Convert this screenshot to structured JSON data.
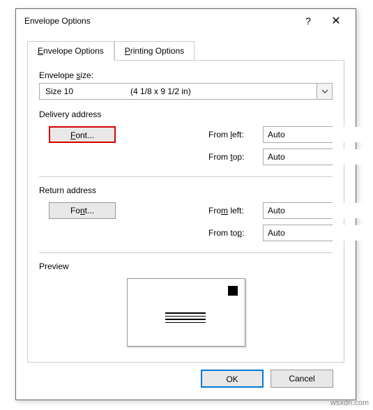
{
  "dialog": {
    "title": "Envelope Options",
    "help": "?",
    "close": "✕"
  },
  "tabs": {
    "envelope": {
      "u": "E",
      "rest": "nvelope Options"
    },
    "printing": {
      "u": "P",
      "rest": "rinting Options"
    }
  },
  "size": {
    "label_pre": "Envelope ",
    "label_u": "s",
    "label_post": "ize:",
    "value": "Size 10",
    "extra": "(4 1/8 x 9 1/2 in)"
  },
  "delivery": {
    "label": "Delivery address",
    "font_u": "F",
    "font_rest": "ont...",
    "from_left_pre": "From ",
    "from_left_u": "l",
    "from_left_post": "eft:",
    "from_left_val": "Auto",
    "from_top_pre": "From ",
    "from_top_u": "t",
    "from_top_post": "op:",
    "from_top_val": "Auto"
  },
  "return": {
    "label": "Return address",
    "font_pre": "Fo",
    "font_u": "n",
    "font_post": "t...",
    "from_left_pre": "Fro",
    "from_left_u": "m",
    "from_left_post": " left:",
    "from_left_val": "Auto",
    "from_top_pre": "From to",
    "from_top_u": "p",
    "from_top_post": ":",
    "from_top_val": "Auto"
  },
  "preview": {
    "label": "Preview"
  },
  "buttons": {
    "ok": "OK",
    "cancel": "Cancel"
  },
  "watermark": "wsxdn.com"
}
